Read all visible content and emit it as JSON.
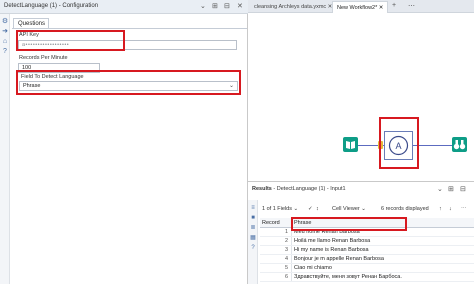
{
  "config_window": {
    "title": "DetectLanguage (1) - Configuration",
    "controls": [
      "⌄",
      "⊞",
      "⊟",
      "✕"
    ],
    "tab_label": "Questions",
    "api_key": {
      "label": "API Key",
      "value": "a••••••••••••••••••"
    },
    "records_per_minute": {
      "label": "Records Per Minute",
      "value": "100"
    },
    "field_to_detect": {
      "label": "Field To Detect Language",
      "value": "Phrase"
    }
  },
  "workflow_tabs": [
    {
      "label": "cleansing Archleys data.yxmc",
      "active": false
    },
    {
      "label": "New Workflow2*",
      "active": true
    }
  ],
  "workflow_tab_controls": [
    "+",
    "⋯"
  ],
  "canvas": {
    "input_tool": "book-icon",
    "language_tool": "language-detect-icon",
    "output_tool": "binoculars-icon",
    "accent_color": "#0e9d87"
  },
  "results": {
    "title_prefix": "Results",
    "title_rest": " - DetectLanguage (1) - Input1",
    "fields_count": "1 of 1 Fields",
    "cell_viewer": "Cell Viewer",
    "records_displayed": "6 records displayed",
    "columns": {
      "record": "Record",
      "phrase": "Phrase"
    },
    "rows": [
      {
        "num": "1",
        "phrase": "Meu nome Renan Barbosa"
      },
      {
        "num": "2",
        "phrase": "Hoilá me llamo Renan Barbosa"
      },
      {
        "num": "3",
        "phrase": "Hi my name is Renan Barbosa"
      },
      {
        "num": "4",
        "phrase": "Bonjour je m appelle Renan Barbosa"
      },
      {
        "num": "5",
        "phrase": "Ciao mi chiamo"
      },
      {
        "num": "6",
        "phrase": "Здравствуйте, меня зовут Ренан Барбоса."
      }
    ]
  }
}
